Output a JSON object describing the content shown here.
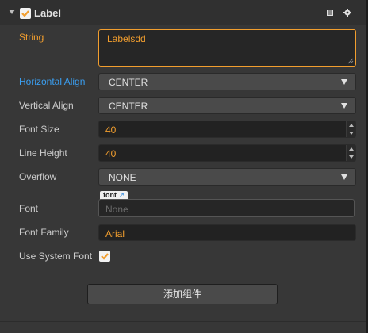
{
  "component": {
    "title": "Label",
    "enabled": true,
    "header_icons": [
      "book-icon",
      "gear-icon"
    ]
  },
  "props": {
    "string": {
      "label": "String",
      "value": "Labelsdd"
    },
    "horizontal_align": {
      "label": "Horizontal Align",
      "value": "CENTER"
    },
    "vertical_align": {
      "label": "Vertical Align",
      "value": "CENTER"
    },
    "font_size": {
      "label": "Font Size",
      "value": "40"
    },
    "line_height": {
      "label": "Line Height",
      "value": "40"
    },
    "overflow": {
      "label": "Overflow",
      "value": "NONE"
    },
    "font": {
      "label": "Font",
      "tag": "font",
      "placeholder": "None"
    },
    "font_family": {
      "label": "Font Family",
      "value": "Arial"
    },
    "use_system_font": {
      "label": "Use System Font",
      "checked": true
    }
  },
  "add_component_label": "添加组件",
  "colors": {
    "accent": "#f29e2e",
    "highlight": "#3a9ef0",
    "panel": "#373737"
  }
}
